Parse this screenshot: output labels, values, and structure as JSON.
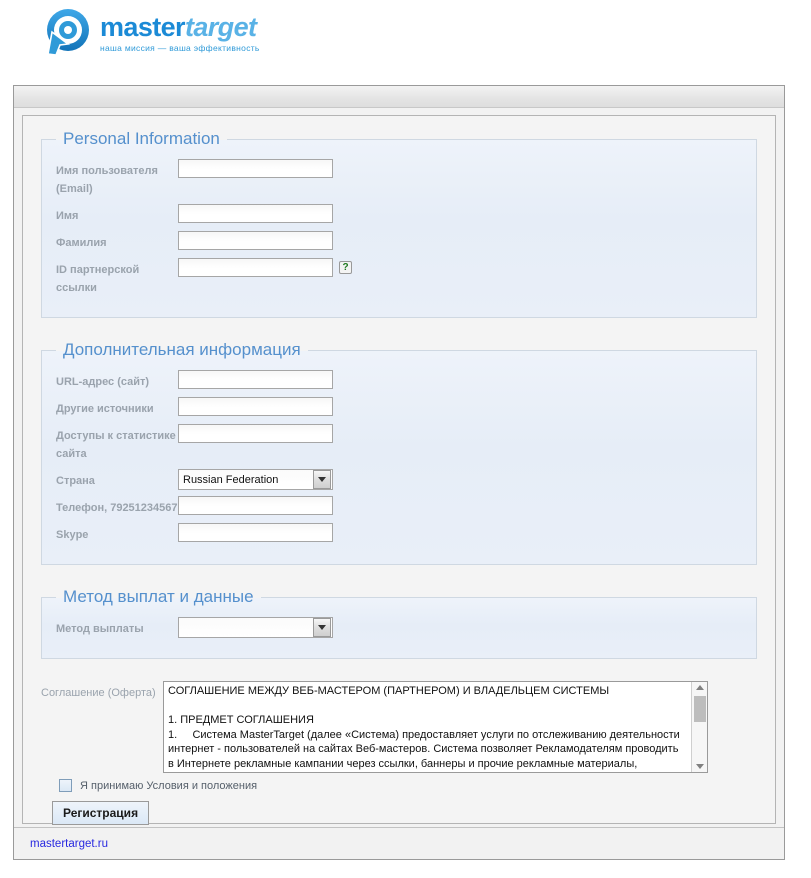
{
  "brand": {
    "name_part1": "master",
    "name_part2": "target",
    "slogan": "наша миссия — ваша эффективность",
    "logo_icon": "target-cursor-icon",
    "accent_blue": "#1b8ad6",
    "accent_light_blue": "#59b2e6"
  },
  "sections": {
    "personal": {
      "legend": "Personal Information",
      "fields": [
        {
          "label": "Имя пользователя (Email)",
          "value": "",
          "type": "text",
          "name": "username-email"
        },
        {
          "label": "Имя",
          "value": "",
          "type": "text",
          "name": "first-name"
        },
        {
          "label": "Фамилия",
          "value": "",
          "type": "text",
          "name": "last-name"
        },
        {
          "label": "ID партнерской ссылки",
          "value": "",
          "type": "text",
          "name": "partner-link-id",
          "help": "?"
        }
      ]
    },
    "additional": {
      "legend": "Дополнительная информация",
      "fields": [
        {
          "label": "URL-адрес (сайт)",
          "value": "",
          "type": "text",
          "name": "website-url"
        },
        {
          "label": "Другие источники",
          "value": "",
          "type": "text",
          "name": "other-sources"
        },
        {
          "label": "Доступы к статистике сайта",
          "value": "",
          "type": "text",
          "name": "stats-access"
        },
        {
          "label": "Страна",
          "value": "Russian Federation",
          "type": "select",
          "name": "country"
        },
        {
          "label": "Телефон, 79251234567",
          "value": "",
          "type": "text",
          "name": "phone"
        },
        {
          "label": "Skype",
          "value": "",
          "type": "text",
          "name": "skype"
        }
      ]
    },
    "payout": {
      "legend": "Метод выплат и данные",
      "fields": [
        {
          "label": "Метод выплаты",
          "value": "",
          "type": "select",
          "name": "payout-method"
        }
      ]
    }
  },
  "agreement": {
    "label": "Соглашение (Оферта)",
    "text": "СОГЛАШЕНИЕ МЕЖДУ ВЕБ-МАСТЕРОМ (ПАРТНЕРОМ) И ВЛАДЕЛЬЦЕМ СИСТЕМЫ\n\n1. ПРЕДМЕТ СОГЛАШЕНИЯ\n1.     Система MasterTarget (далее «Система) предоставляет услуги по отслеживанию деятельности интернет - пользователей на сайтах Веб-мастеров. Система позволяет Рекламодателям проводить в Интернете рекламные кампании через ссылки, баннеры и прочие рекламные материалы, размещенные на сайтах Веб-мастеров. Это может побудить посетителей к переходу на сайты",
    "checkbox_label": "Я принимаю Условия и положения",
    "checkbox_checked": false,
    "submit_label": "Регистрация"
  },
  "footer": {
    "link_text": "mastertarget.ru"
  }
}
